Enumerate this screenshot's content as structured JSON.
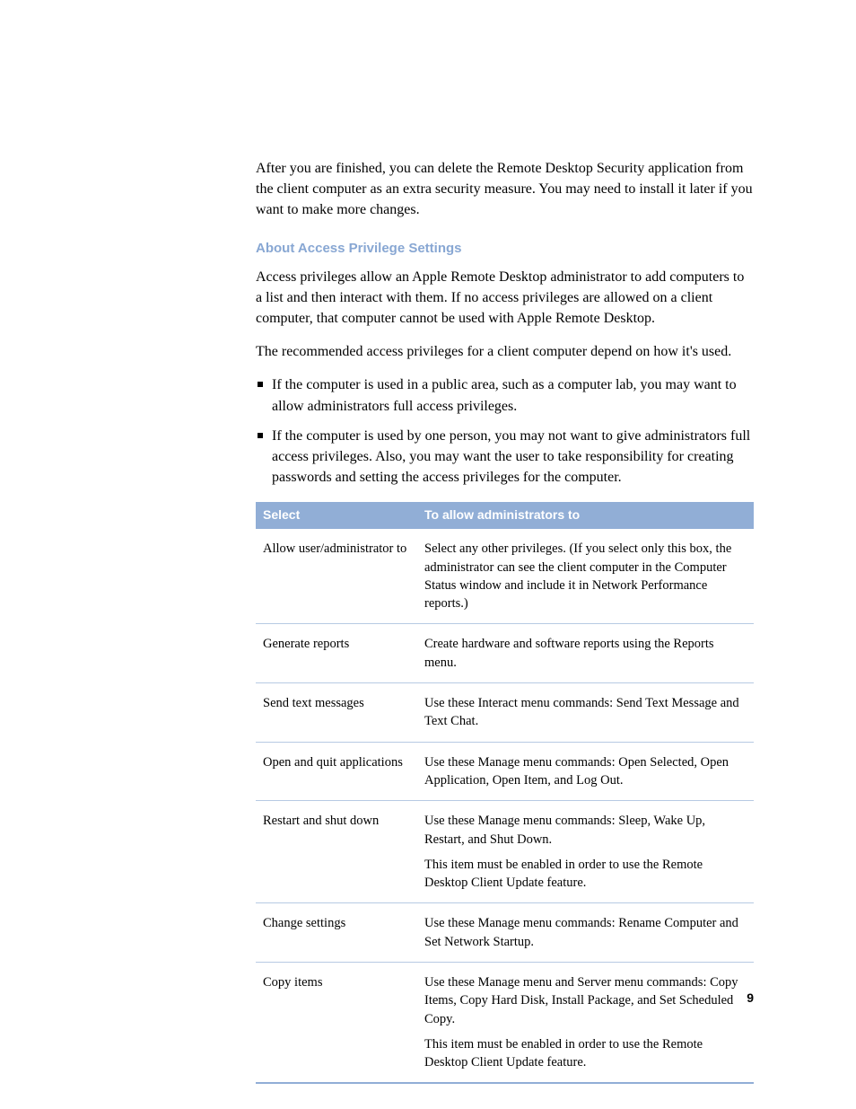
{
  "intro_para": "After you are finished, you can delete the Remote Desktop Security application from the client computer as an extra security measure. You may need to install it later if you want to make more changes.",
  "section_heading": "About Access Privilege Settings",
  "para1": "Access privileges allow an Apple Remote Desktop administrator to add computers to a list and then interact with them. If no access privileges are allowed on a client computer, that computer cannot be used with Apple Remote Desktop.",
  "para2": "The recommended access privileges for a client computer depend on how it's used.",
  "bullets": [
    "If the computer is used in a public area, such as a computer lab, you may want to allow administrators full access privileges.",
    "If the computer is used by one person, you may not want to give administrators full access privileges. Also, you may want the user to take responsibility for creating passwords and setting the access privileges for the computer."
  ],
  "table": {
    "header": {
      "col1": "Select",
      "col2": "To allow administrators to"
    },
    "rows": [
      {
        "select": "Allow user/administrator to",
        "desc": [
          "Select any other privileges. (If you select only this box, the administrator can see the client computer in the Computer Status window and include it in Network Performance reports.)"
        ]
      },
      {
        "select": "Generate reports",
        "desc": [
          "Create hardware and software reports using the Reports menu."
        ]
      },
      {
        "select": "Send text messages",
        "desc": [
          "Use these Interact menu commands:  Send Text Message and Text Chat."
        ]
      },
      {
        "select": "Open and quit applications",
        "desc": [
          "Use these Manage menu commands:  Open Selected, Open Application, Open Item, and Log Out."
        ]
      },
      {
        "select": "Restart and shut down",
        "desc": [
          "Use these Manage menu commands:  Sleep, Wake Up, Restart, and Shut Down.",
          "This item must be enabled in order to use the Remote Desktop Client Update feature."
        ]
      },
      {
        "select": "Change settings",
        "desc": [
          "Use these Manage menu commands:  Rename Computer and Set Network Startup."
        ]
      },
      {
        "select": "Copy items",
        "desc": [
          "Use these Manage menu and Server menu commands:  Copy Items, Copy Hard Disk, Install Package, and Set Scheduled Copy.",
          "This item must be enabled in order to use the Remote Desktop Client Update feature."
        ]
      }
    ]
  },
  "page_number": "9"
}
